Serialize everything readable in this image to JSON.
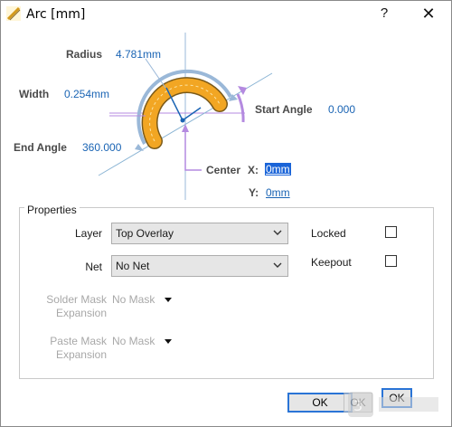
{
  "window": {
    "title": "Arc [mm]",
    "help_symbol": "?",
    "close_symbol": "✕"
  },
  "diagram": {
    "radius_label": "Radius",
    "radius_value": "4.781mm",
    "width_label": "Width",
    "width_value": "0.254mm",
    "start_angle_label": "Start Angle",
    "start_angle_value": "0.000",
    "end_angle_label": "End Angle",
    "end_angle_value": "360.000",
    "center_label": "Center",
    "x_label": "X:",
    "x_value": "0mm",
    "y_label": "Y:",
    "y_value": "0mm",
    "arc_color": "#f2a623",
    "arc_outline_color": "#7a5a1a",
    "guide_color": "#b48ae0",
    "dim_color": "#8ab4d4"
  },
  "properties": {
    "group_title": "Properties",
    "layer_label": "Layer",
    "layer_value": "Top Overlay",
    "net_label": "Net",
    "net_value": "No Net",
    "locked_label": "Locked",
    "locked_checked": false,
    "keepout_label": "Keepout",
    "keepout_checked": false,
    "solder_mask_label_1": "Solder Mask",
    "solder_mask_label_2": "Expansion",
    "solder_mask_value": "No Mask",
    "paste_mask_label_1": "Paste Mask",
    "paste_mask_label_2": "Expansion",
    "paste_mask_value": "No Mask"
  },
  "footer": {
    "ok_label": "OK",
    "ok_label_2": "OK",
    "ok_label_3": "OK"
  },
  "icons": {
    "app_icon": "arc-icon",
    "chevron": "chevron-down-icon",
    "dropdown": "triangle-down-icon"
  }
}
